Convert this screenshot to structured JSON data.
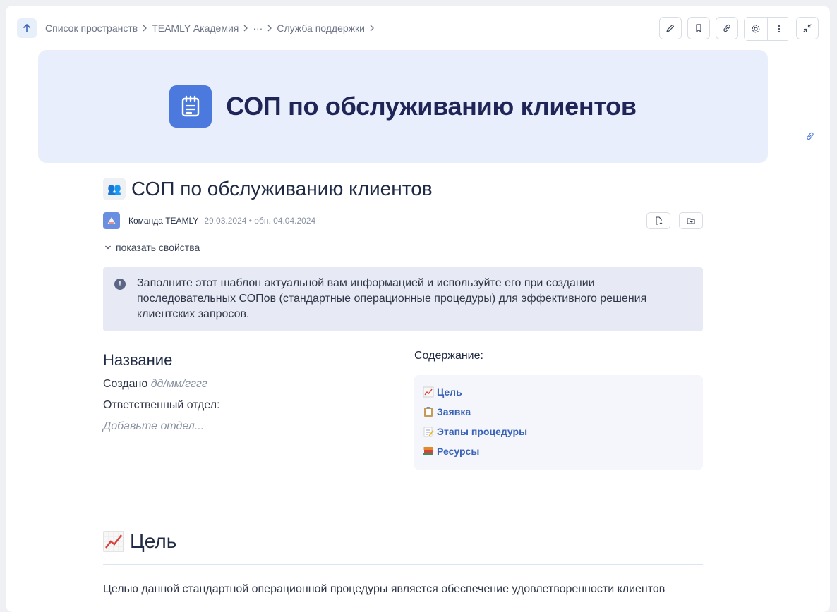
{
  "breadcrumb": {
    "items": [
      "Список пространств",
      "TEAMLY Академия",
      "···",
      "Служба поддержки"
    ]
  },
  "toolbar": {
    "icons": [
      "pencil-icon",
      "bookmark-icon",
      "link-icon",
      "gear-icon",
      "more-vertical-icon",
      "collapse-icon"
    ]
  },
  "banner": {
    "title": "СОП по обслуживанию клиентов",
    "icon": "notepad-icon",
    "background": "#e8eefb",
    "icon_color": "#4c79dd"
  },
  "document": {
    "emoji": "👥",
    "title": "СОП по обслуживанию клиентов",
    "author": "Команда TEAMLY",
    "dates": "29.03.2024 • обн. 04.04.2024",
    "show_props": "показать свойства"
  },
  "callout": {
    "text": "Заполните этот шаблон актуальной вам информацией и используйте его при создании последовательных СОПов (стандартные операционные процедуры) для эффективного решения клиентских запросов."
  },
  "info": {
    "heading": "Название",
    "created_label": "Создано",
    "created_value": "дд/мм/гггг",
    "department_label": "Ответственный отдел:",
    "department_placeholder": "Добавьте отдел..."
  },
  "toc": {
    "title": "Содержание:",
    "items": [
      {
        "label": "Цель",
        "icon": "chart-up-icon"
      },
      {
        "label": "Заявка",
        "icon": "clipboard-icon"
      },
      {
        "label": "Этапы процедуры",
        "icon": "memo-icon"
      },
      {
        "label": "Ресурсы",
        "icon": "books-icon"
      }
    ]
  },
  "section": {
    "title": "Цель",
    "icon": "chart-up-icon",
    "text": "Целью данной стандартной операционной процедуры является обеспечение удовлетворенности клиентов"
  },
  "colors": {
    "link": "#3a63b8",
    "accent": "#4c79dd"
  }
}
